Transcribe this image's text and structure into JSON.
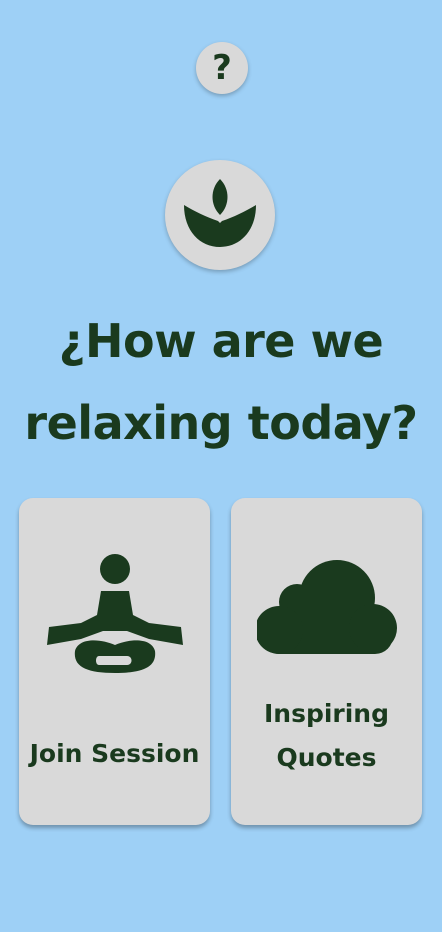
{
  "help_button": {
    "symbol": "?"
  },
  "logo": {
    "icon": "lotus-icon"
  },
  "heading": {
    "line1": "¿How are we",
    "line2": "relaxing today?"
  },
  "cards": [
    {
      "icon": "meditation-icon",
      "label": "Join Session"
    },
    {
      "icon": "cloud-icon",
      "label_line1": "Inspiring",
      "label_line2": "Quotes"
    }
  ],
  "colors": {
    "background": "#9ed0f6",
    "card": "#d9d9d9",
    "accent": "#1a3a1e"
  }
}
